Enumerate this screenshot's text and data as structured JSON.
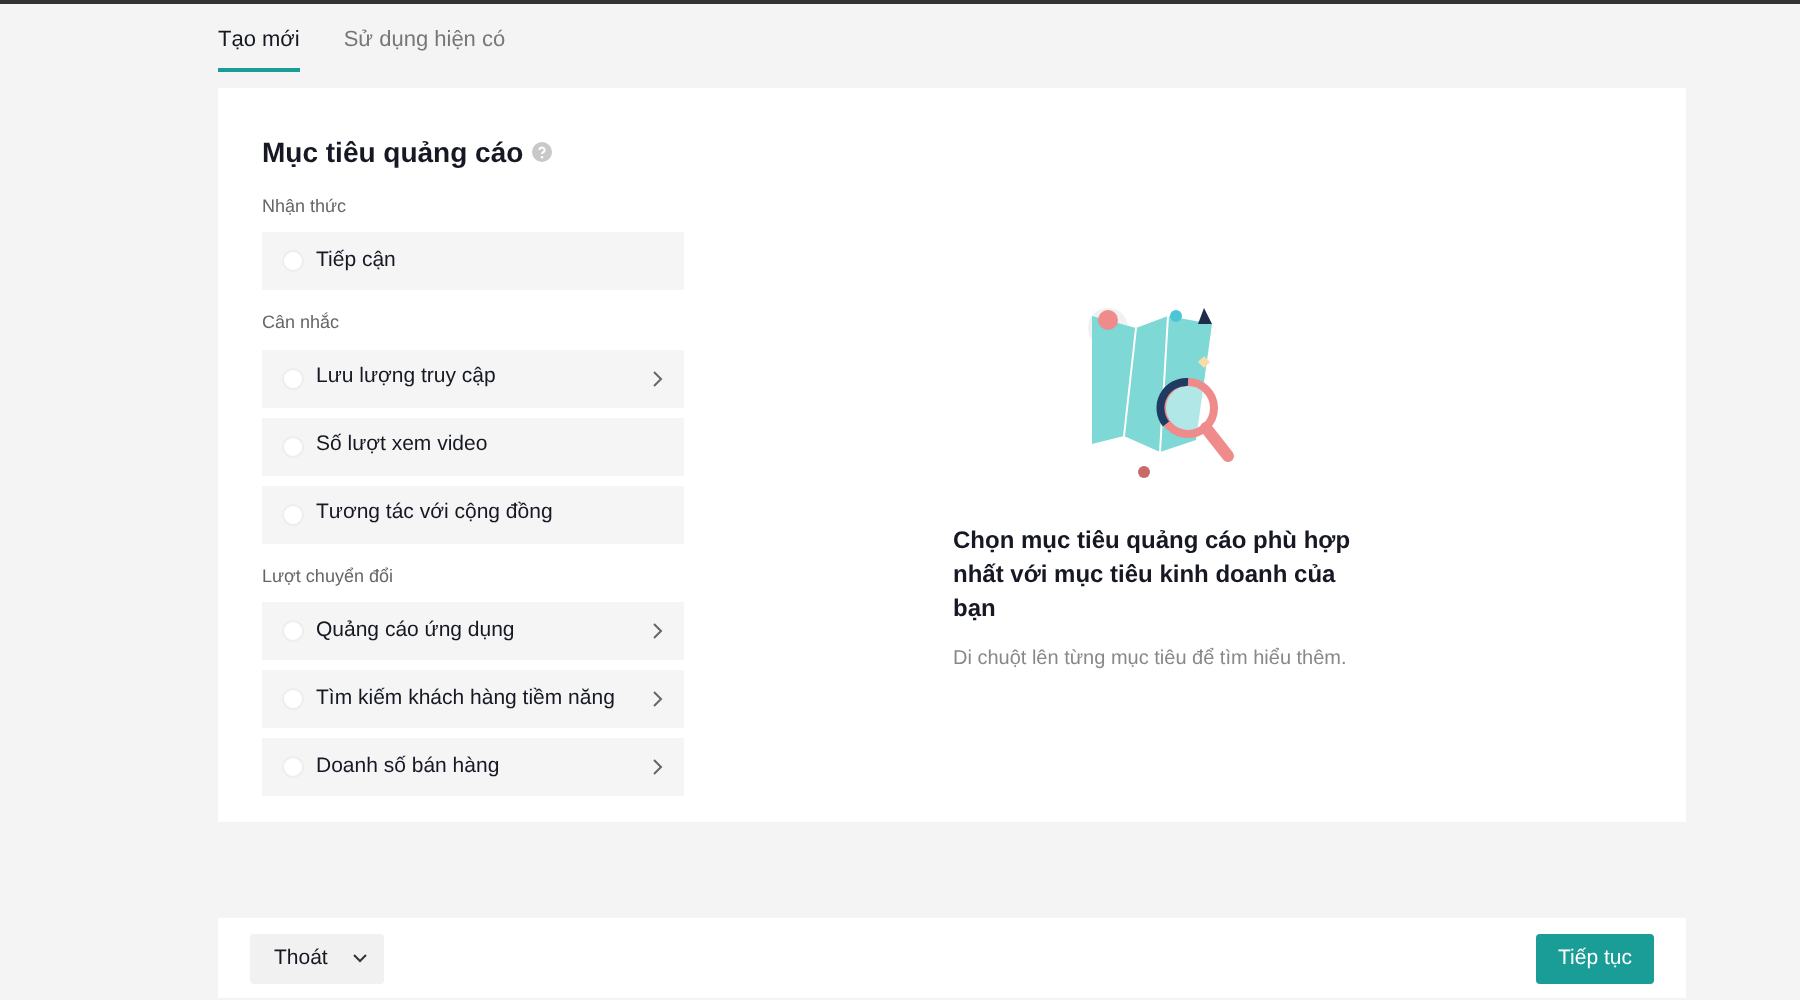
{
  "tabs": [
    {
      "label": "Tạo mới",
      "selected": true
    },
    {
      "label": "Sử dụng hiện có",
      "selected": false
    }
  ],
  "objective": {
    "title": "Mục tiêu quảng cáo",
    "groups": [
      {
        "heading": "Nhận thức",
        "items": [
          {
            "label": "Tiếp cận",
            "selected": false,
            "has_submenu": false
          }
        ]
      },
      {
        "heading": "Cân nhắc",
        "items": [
          {
            "label": "Lưu lượng truy cập",
            "selected": false,
            "has_submenu": true
          },
          {
            "label": "Số lượt xem video",
            "selected": false,
            "has_submenu": false
          },
          {
            "label": "Tương tác với cộng đồng",
            "selected": false,
            "has_submenu": false
          }
        ]
      },
      {
        "heading": "Lượt chuyển đổi",
        "items": [
          {
            "label": "Quảng cáo ứng dụng",
            "selected": false,
            "has_submenu": true
          },
          {
            "label": "Tìm kiếm khách hàng tiềm năng",
            "selected": false,
            "has_submenu": true
          },
          {
            "label": "Doanh số bán hàng",
            "selected": false,
            "has_submenu": true
          }
        ]
      }
    ]
  },
  "empty_state": {
    "title": "Chọn mục tiêu quảng cáo phù hợp nhất với mục tiêu kinh doanh của bạn",
    "hint": "Di chuột lên từng mục tiêu để tìm hiểu thêm."
  },
  "footer": {
    "exit_button": "Thoát",
    "continue_button": "Tiếp tục"
  }
}
